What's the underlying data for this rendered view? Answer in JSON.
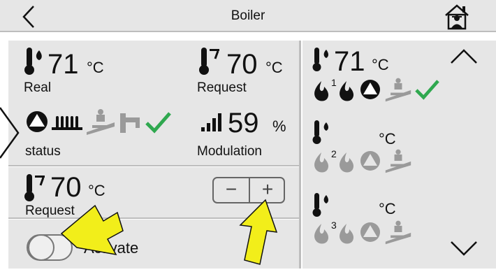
{
  "header": {
    "title": "Boiler"
  },
  "boiler": {
    "real": {
      "value": "71",
      "unit": "°C",
      "label": "Real"
    },
    "request": {
      "value": "70",
      "unit": "°C",
      "label": "Request"
    },
    "status": {
      "label": "status"
    },
    "modulation": {
      "value": "59",
      "unit": "%",
      "label": "Modulation"
    },
    "setpoint": {
      "value": "70",
      "unit": "°C",
      "label": "Request",
      "minus": "−",
      "plus": "+"
    },
    "activate": {
      "label": "Activate"
    }
  },
  "right_panel": {
    "items": [
      {
        "temp": "71",
        "unit": "°C",
        "index": "1"
      },
      {
        "temp": "",
        "unit": "°C",
        "index": "2"
      },
      {
        "temp": "",
        "unit": "°C",
        "index": "3"
      }
    ]
  },
  "colors": {
    "check": "#2fa84f",
    "arrow": "#f2ee1a",
    "panel": "#e6e6e6",
    "grey_icon": "#9a9a9a"
  }
}
